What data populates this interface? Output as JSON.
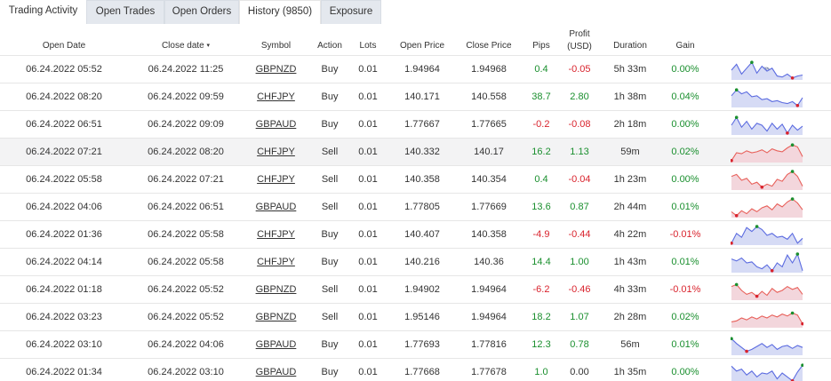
{
  "tabs": [
    {
      "label": "Trading Activity"
    },
    {
      "label": "Open Trades"
    },
    {
      "label": "Open Orders"
    },
    {
      "label": "History (9850)"
    },
    {
      "label": "Exposure"
    }
  ],
  "columns": {
    "open_date": "Open Date",
    "close_date": "Close date",
    "sort_caret": "▾",
    "symbol": "Symbol",
    "action": "Action",
    "lots": "Lots",
    "open_price": "Open Price",
    "close_price": "Close Price",
    "pips": "Pips",
    "profit_line1": "Profit",
    "profit_line2": "(USD)",
    "duration": "Duration",
    "gain": "Gain",
    "chart_icon": "globe-icon"
  },
  "colors": {
    "positive": "#1a8f2e",
    "negative": "#d9232d",
    "spark_line": "#5b6be0",
    "spark_fill": "#d6dbf5",
    "spark_loss": "#e8605a"
  },
  "rows": [
    {
      "open": "06.24.2022 05:52",
      "close": "06.24.2022 11:25",
      "symbol": "GBPNZD",
      "action": "Buy",
      "lots": "0.01",
      "open_price": "1.94964",
      "close_price": "1.94968",
      "pips": "0.4",
      "profit": "-0.05",
      "duration": "5h 33m",
      "gain": "0.00%",
      "pips_sign": "pos",
      "profit_sign": "neg",
      "gain_sign": "pos",
      "spark": [
        0.5,
        0.8,
        0.3,
        0.6,
        0.9,
        0.35,
        0.7,
        0.45,
        0.6,
        0.2,
        0.15,
        0.3,
        0.1,
        0.2,
        0.25
      ],
      "spark_kind": "blue"
    },
    {
      "open": "06.24.2022 08:20",
      "close": "06.24.2022 09:59",
      "symbol": "CHFJPY",
      "action": "Buy",
      "lots": "0.01",
      "open_price": "140.171",
      "close_price": "140.558",
      "pips": "38.7",
      "profit": "2.80",
      "duration": "1h 38m",
      "gain": "0.04%",
      "pips_sign": "pos",
      "profit_sign": "pos",
      "gain_sign": "pos",
      "spark": [
        0.6,
        0.9,
        0.7,
        0.8,
        0.55,
        0.6,
        0.4,
        0.45,
        0.3,
        0.35,
        0.25,
        0.2,
        0.3,
        0.1,
        0.5
      ],
      "spark_kind": "blue"
    },
    {
      "open": "06.24.2022 06:51",
      "close": "06.24.2022 09:09",
      "symbol": "GBPAUD",
      "action": "Buy",
      "lots": "0.01",
      "open_price": "1.77667",
      "close_price": "1.77665",
      "pips": "-0.2",
      "profit": "-0.08",
      "duration": "2h 18m",
      "gain": "0.00%",
      "pips_sign": "neg",
      "profit_sign": "neg",
      "gain_sign": "pos",
      "spark": [
        0.5,
        0.9,
        0.4,
        0.7,
        0.3,
        0.6,
        0.5,
        0.2,
        0.6,
        0.3,
        0.55,
        0.1,
        0.5,
        0.25,
        0.45
      ],
      "spark_kind": "blue"
    },
    {
      "open": "06.24.2022 07:21",
      "close": "06.24.2022 08:20",
      "symbol": "CHFJPY",
      "action": "Sell",
      "lots": "0.01",
      "open_price": "140.332",
      "close_price": "140.17",
      "pips": "16.2",
      "profit": "1.13",
      "duration": "59m",
      "gain": "0.02%",
      "pips_sign": "pos",
      "profit_sign": "pos",
      "gain_sign": "pos",
      "spark": [
        0.1,
        0.5,
        0.45,
        0.6,
        0.5,
        0.55,
        0.65,
        0.5,
        0.7,
        0.6,
        0.55,
        0.75,
        0.9,
        0.8,
        0.3
      ],
      "spark_kind": "red"
    },
    {
      "open": "06.24.2022 05:58",
      "close": "06.24.2022 07:21",
      "symbol": "CHFJPY",
      "action": "Sell",
      "lots": "0.01",
      "open_price": "140.358",
      "close_price": "140.354",
      "pips": "0.4",
      "profit": "-0.04",
      "duration": "1h 23m",
      "gain": "0.00%",
      "pips_sign": "pos",
      "profit_sign": "neg",
      "gain_sign": "pos",
      "spark": [
        0.7,
        0.8,
        0.5,
        0.6,
        0.3,
        0.4,
        0.15,
        0.3,
        0.2,
        0.55,
        0.45,
        0.8,
        0.95,
        0.7,
        0.2
      ],
      "spark_kind": "red"
    },
    {
      "open": "06.24.2022 04:06",
      "close": "06.24.2022 06:51",
      "symbol": "GBPAUD",
      "action": "Sell",
      "lots": "0.01",
      "open_price": "1.77805",
      "close_price": "1.77669",
      "pips": "13.6",
      "profit": "0.87",
      "duration": "2h 44m",
      "gain": "0.01%",
      "pips_sign": "pos",
      "profit_sign": "pos",
      "gain_sign": "pos",
      "spark": [
        0.3,
        0.1,
        0.35,
        0.2,
        0.45,
        0.3,
        0.5,
        0.6,
        0.4,
        0.7,
        0.55,
        0.8,
        0.95,
        0.75,
        0.4
      ],
      "spark_kind": "red"
    },
    {
      "open": "06.24.2022 01:36",
      "close": "06.24.2022 05:58",
      "symbol": "CHFJPY",
      "action": "Buy",
      "lots": "0.01",
      "open_price": "140.407",
      "close_price": "140.358",
      "pips": "-4.9",
      "profit": "-0.44",
      "duration": "4h 22m",
      "gain": "-0.01%",
      "pips_sign": "neg",
      "profit_sign": "neg",
      "gain_sign": "neg",
      "spark": [
        0.1,
        0.6,
        0.4,
        0.9,
        0.7,
        0.95,
        0.8,
        0.5,
        0.6,
        0.4,
        0.45,
        0.3,
        0.6,
        0.1,
        0.35
      ],
      "spark_kind": "blue"
    },
    {
      "open": "06.24.2022 04:14",
      "close": "06.24.2022 05:58",
      "symbol": "CHFJPY",
      "action": "Buy",
      "lots": "0.01",
      "open_price": "140.216",
      "close_price": "140.36",
      "pips": "14.4",
      "profit": "1.00",
      "duration": "1h 43m",
      "gain": "0.01%",
      "pips_sign": "pos",
      "profit_sign": "pos",
      "gain_sign": "pos",
      "spark": [
        0.7,
        0.6,
        0.75,
        0.5,
        0.55,
        0.3,
        0.2,
        0.4,
        0.1,
        0.5,
        0.3,
        0.9,
        0.5,
        0.95,
        0.1
      ],
      "spark_kind": "blue"
    },
    {
      "open": "06.24.2022 01:18",
      "close": "06.24.2022 05:52",
      "symbol": "GBPNZD",
      "action": "Sell",
      "lots": "0.01",
      "open_price": "1.94902",
      "close_price": "1.94964",
      "pips": "-6.2",
      "profit": "-0.46",
      "duration": "4h 33m",
      "gain": "-0.01%",
      "pips_sign": "neg",
      "profit_sign": "neg",
      "gain_sign": "neg",
      "spark": [
        0.7,
        0.8,
        0.5,
        0.3,
        0.4,
        0.2,
        0.45,
        0.25,
        0.6,
        0.4,
        0.5,
        0.7,
        0.55,
        0.65,
        0.3
      ],
      "spark_kind": "red"
    },
    {
      "open": "06.24.2022 03:23",
      "close": "06.24.2022 05:52",
      "symbol": "GBPNZD",
      "action": "Sell",
      "lots": "0.01",
      "open_price": "1.95146",
      "close_price": "1.94964",
      "pips": "18.2",
      "profit": "1.07",
      "duration": "2h 28m",
      "gain": "0.02%",
      "pips_sign": "pos",
      "profit_sign": "pos",
      "gain_sign": "pos",
      "spark": [
        0.3,
        0.35,
        0.5,
        0.4,
        0.55,
        0.45,
        0.6,
        0.5,
        0.65,
        0.55,
        0.7,
        0.6,
        0.75,
        0.65,
        0.2
      ],
      "spark_kind": "red"
    },
    {
      "open": "06.24.2022 03:10",
      "close": "06.24.2022 04:06",
      "symbol": "GBPAUD",
      "action": "Buy",
      "lots": "0.01",
      "open_price": "1.77693",
      "close_price": "1.77816",
      "pips": "12.3",
      "profit": "0.78",
      "duration": "56m",
      "gain": "0.01%",
      "pips_sign": "pos",
      "profit_sign": "pos",
      "gain_sign": "pos",
      "spark": [
        0.85,
        0.6,
        0.4,
        0.2,
        0.3,
        0.45,
        0.6,
        0.4,
        0.55,
        0.3,
        0.45,
        0.5,
        0.35,
        0.5,
        0.4
      ],
      "spark_kind": "blue"
    },
    {
      "open": "06.24.2022 01:34",
      "close": "06.24.2022 03:10",
      "symbol": "GBPAUD",
      "action": "Buy",
      "lots": "0.01",
      "open_price": "1.77668",
      "close_price": "1.77678",
      "pips": "1.0",
      "profit": "0.00",
      "duration": "1h 35m",
      "gain": "0.00%",
      "pips_sign": "pos",
      "profit_sign": "neutral",
      "gain_sign": "pos",
      "spark": [
        0.85,
        0.6,
        0.7,
        0.4,
        0.6,
        0.3,
        0.5,
        0.45,
        0.6,
        0.2,
        0.5,
        0.3,
        0.1,
        0.55,
        0.9
      ],
      "spark_kind": "blue"
    }
  ]
}
